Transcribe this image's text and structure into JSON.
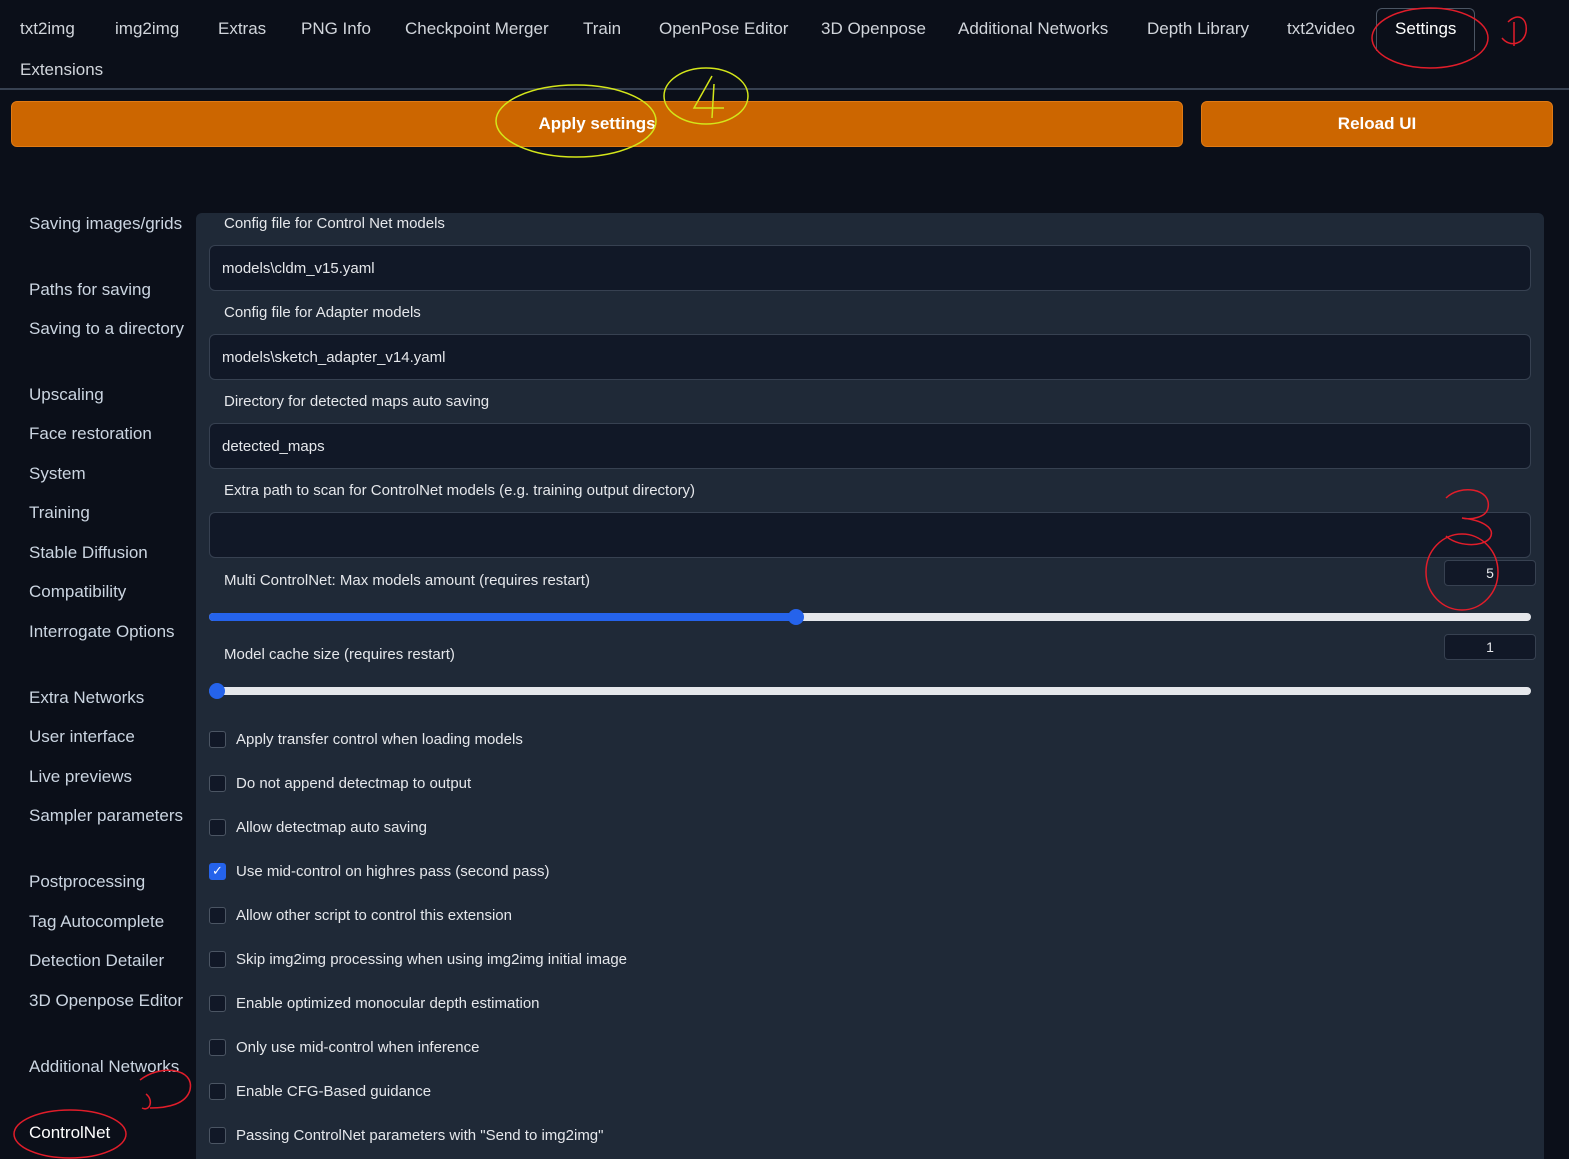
{
  "tabs": [
    {
      "label": "txt2img"
    },
    {
      "label": "img2img"
    },
    {
      "label": "Extras"
    },
    {
      "label": "PNG Info"
    },
    {
      "label": "Checkpoint Merger"
    },
    {
      "label": "Train"
    },
    {
      "label": "OpenPose Editor"
    },
    {
      "label": "3D Openpose"
    },
    {
      "label": "Additional Networks"
    },
    {
      "label": "Depth Library"
    },
    {
      "label": "txt2video"
    },
    {
      "label": "Settings"
    },
    {
      "label": "Extensions"
    }
  ],
  "actions": {
    "apply_label": "Apply settings",
    "reload_label": "Reload UI"
  },
  "sidebar": {
    "items": [
      {
        "label": "Saving images/grids"
      },
      {
        "label": "Paths for saving"
      },
      {
        "label": "Saving to a directory"
      },
      {
        "label": "Upscaling"
      },
      {
        "label": "Face restoration"
      },
      {
        "label": "System"
      },
      {
        "label": "Training"
      },
      {
        "label": "Stable Diffusion"
      },
      {
        "label": "Compatibility"
      },
      {
        "label": "Interrogate Options"
      },
      {
        "label": "Extra Networks"
      },
      {
        "label": "User interface"
      },
      {
        "label": "Live previews"
      },
      {
        "label": "Sampler parameters"
      },
      {
        "label": "Postprocessing"
      },
      {
        "label": "Tag Autocomplete"
      },
      {
        "label": "Detection Detailer"
      },
      {
        "label": "3D Openpose Editor"
      },
      {
        "label": "Additional Networks"
      },
      {
        "label": "ControlNet"
      }
    ]
  },
  "settings": {
    "config_cn": {
      "label": "Config file for Control Net models",
      "value": "models\\cldm_v15.yaml"
    },
    "config_adapter": {
      "label": "Config file for Adapter models",
      "value": "models\\sketch_adapter_v14.yaml"
    },
    "detected_dir": {
      "label": "Directory for detected maps auto saving",
      "value": "detected_maps"
    },
    "extra_path": {
      "label": "Extra path to scan for ControlNet models (e.g. training output directory)",
      "value": ""
    },
    "max_models": {
      "label": "Multi ControlNet: Max models amount (requires restart)",
      "value": "5",
      "fraction": 0.444
    },
    "cache_size": {
      "label": "Model cache size (requires restart)",
      "value": "1",
      "fraction": 0.0
    }
  },
  "checkboxes": [
    {
      "label": "Apply transfer control when loading models",
      "checked": false
    },
    {
      "label": "Do not append detectmap to output",
      "checked": false
    },
    {
      "label": "Allow detectmap auto saving",
      "checked": false
    },
    {
      "label": "Use mid-control on highres pass (second pass)",
      "checked": true
    },
    {
      "label": "Allow other script to control this extension",
      "checked": false
    },
    {
      "label": "Skip img2img processing when using img2img initial image",
      "checked": false
    },
    {
      "label": "Enable optimized monocular depth estimation",
      "checked": false
    },
    {
      "label": "Only use mid-control when inference",
      "checked": false
    },
    {
      "label": "Enable CFG-Based guidance",
      "checked": false
    },
    {
      "label": "Passing ControlNet parameters with \"Send to img2img\"",
      "checked": false
    }
  ],
  "colors": {
    "accent": "#cc6600",
    "slider": "#2563eb",
    "annotation_red": "#e11d2a",
    "annotation_yellow": "#d4e61a"
  }
}
